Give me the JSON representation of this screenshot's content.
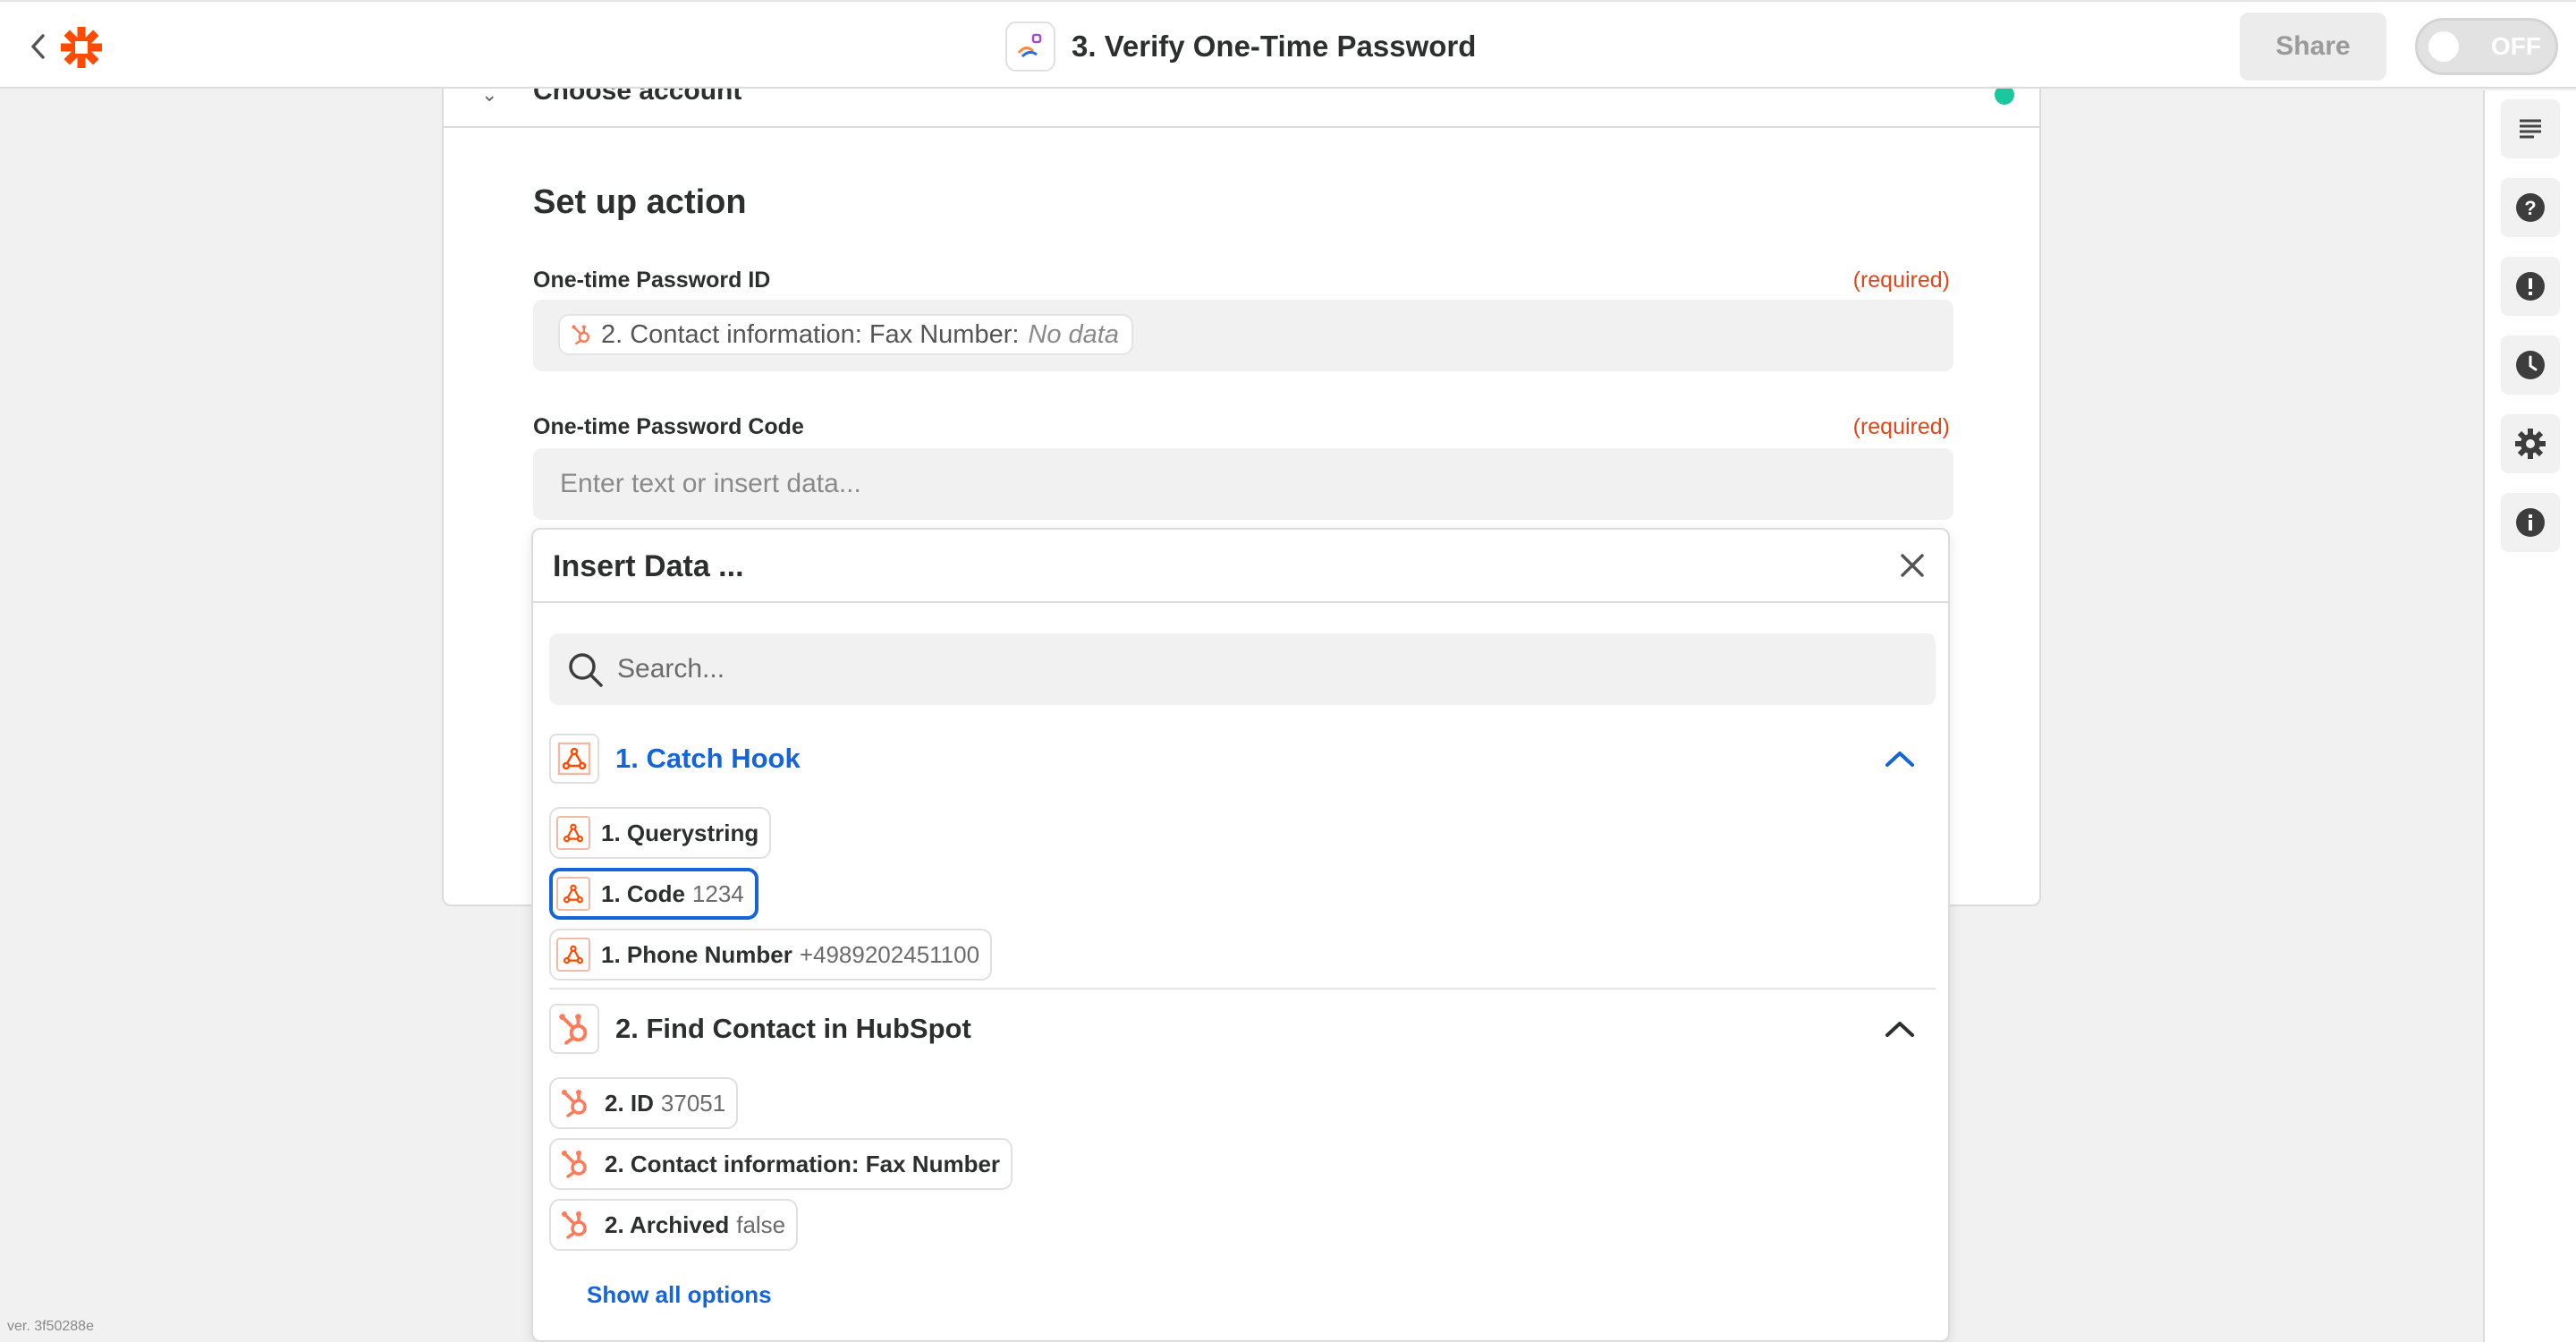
{
  "header": {
    "title": "3. Verify One-Time Password",
    "share_label": "Share",
    "toggle_label": "OFF",
    "brand_color": "#ff4a00"
  },
  "card": {
    "choose_account_label": "Choose account",
    "section_title": "Set up action",
    "fields": [
      {
        "label": "One-time Password ID",
        "required": "(required)",
        "value_pill": {
          "text": "2. Contact information: Fax Number:",
          "nodata": "No data"
        }
      },
      {
        "label": "One-time Password Code",
        "required": "(required)",
        "placeholder": "Enter text or insert data..."
      }
    ]
  },
  "insert_data": {
    "title": "Insert Data ...",
    "search_placeholder": "Search...",
    "groups": [
      {
        "title": "1. Catch Hook",
        "color": "#1565d8",
        "icon": "webhook-icon",
        "items": [
          {
            "name": "1. Querystring",
            "value": ""
          },
          {
            "name": "1. Code",
            "value": "1234",
            "selected": true
          },
          {
            "name": "1. Phone Number",
            "value": "+4989202451100"
          }
        ]
      },
      {
        "title": "2. Find Contact in HubSpot",
        "color": "#2d2e2e",
        "icon": "hubspot-icon",
        "items": [
          {
            "name": "2. ID",
            "value": "37051"
          },
          {
            "name": "2. Contact information: Fax Number",
            "value": ""
          },
          {
            "name": "2. Archived",
            "value": "false"
          }
        ]
      }
    ],
    "show_all_label": "Show all options"
  },
  "rail": {
    "buttons": [
      "outline-icon",
      "help-icon",
      "alert-icon",
      "history-icon",
      "settings-icon",
      "info-icon"
    ]
  },
  "footer": {
    "version": "ver. 3f50288e"
  }
}
